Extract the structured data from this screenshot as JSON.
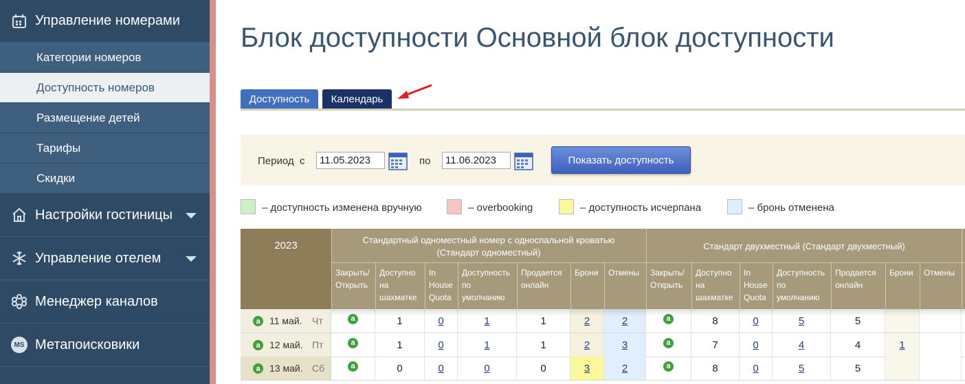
{
  "sidebar": {
    "sections": [
      {
        "label": "Управление номерами",
        "icon": "calendar-icon"
      },
      {
        "label": "Настройки гостиницы",
        "icon": "house-icon"
      },
      {
        "label": "Управление отелем",
        "icon": "snowflake-icon"
      },
      {
        "label": "Менеджер каналов",
        "icon": "hub-icon"
      },
      {
        "label": "Метапоисковики",
        "icon": "ms-badge-icon",
        "badge": "MS"
      }
    ],
    "sub_items": [
      {
        "label": "Категории номеров"
      },
      {
        "label": "Доступность номеров",
        "active": true
      },
      {
        "label": "Размещение детей"
      },
      {
        "label": "Тарифы"
      },
      {
        "label": "Скидки"
      }
    ]
  },
  "page": {
    "title": "Блок доступности Основной блок доступности"
  },
  "tabs": [
    {
      "label": "Доступность"
    },
    {
      "label": "Календарь",
      "active": true
    }
  ],
  "filter": {
    "period_label": "Период",
    "from_label": "с",
    "to_label": "по",
    "date_from": "11.05.2023",
    "date_to": "11.06.2023",
    "show_button": "Показать доступность"
  },
  "legend": [
    {
      "color": "#ccf1c7",
      "text": "– доступность изменена вручную"
    },
    {
      "color": "#f7c5c2",
      "text": "– overbooking"
    },
    {
      "color": "#fbf89a",
      "text": "– доступность исчерпана"
    },
    {
      "color": "#e1eefb",
      "text": "– бронь отменена"
    }
  ],
  "table": {
    "year": "2023",
    "groups": [
      {
        "title_line1": "Стандартный одноместный номер с односпальной кроватью",
        "title_line2": "(Стандарт одноместный)"
      },
      {
        "title_line1": "Стандарт двухместный (Стандарт двухместный)"
      }
    ],
    "columns": [
      [
        "Закрыть/",
        "Открыть"
      ],
      [
        "Доступно",
        "на",
        "шахматке"
      ],
      [
        "In",
        "House",
        "Quota"
      ],
      [
        "Доступность",
        "по",
        "умолчанию"
      ],
      [
        "Продается",
        "онлайн"
      ],
      [
        "Брони"
      ],
      [
        "Отмены"
      ]
    ],
    "rows": [
      {
        "date": "11 май.",
        "dow": "Чт",
        "g1": {
          "avail": "1",
          "inhouse": "0",
          "default": "1",
          "online": "1",
          "bookings": "2",
          "cancels": "2"
        },
        "g2": {
          "avail": "8",
          "inhouse": "0",
          "default": "5",
          "online": "5",
          "bookings": "",
          "cancels": ""
        }
      },
      {
        "date": "12 май.",
        "dow": "Пт",
        "g1": {
          "avail": "1",
          "inhouse": "0",
          "default": "1",
          "online": "1",
          "bookings": "2",
          "cancels": "3"
        },
        "g2": {
          "avail": "7",
          "inhouse": "0",
          "default": "4",
          "online": "4",
          "bookings": "1",
          "cancels": ""
        }
      },
      {
        "date": "13 май.",
        "dow": "Сб",
        "g1": {
          "avail": "0",
          "inhouse": "0",
          "default": "0",
          "online": "0",
          "bookings": "3",
          "cancels": "2"
        },
        "g2": {
          "avail": "8",
          "inhouse": "0",
          "default": "5",
          "online": "5",
          "bookings": "",
          "cancels": ""
        }
      }
    ]
  },
  "colors": {
    "sidebar": "#2f4a65",
    "accent": "#3f6fbd",
    "header": "#a69a7b"
  }
}
